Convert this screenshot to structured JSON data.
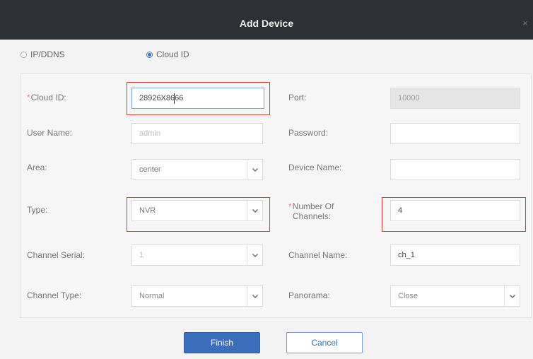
{
  "dialog": {
    "title": "Add Device",
    "close_glyph": "×"
  },
  "mode": {
    "options": [
      {
        "label": "IP/DDNS",
        "selected": false
      },
      {
        "label": "Cloud ID",
        "selected": true
      }
    ]
  },
  "form": {
    "cloud_id": {
      "label": "Cloud ID:",
      "value": "28926X8666",
      "required": true
    },
    "port": {
      "label": "Port:",
      "value": "10000"
    },
    "user_name": {
      "label": "User Name:",
      "value": "admin"
    },
    "password": {
      "label": "Password:",
      "value": ""
    },
    "area": {
      "label": "Area:",
      "value": "center"
    },
    "device_name": {
      "label": "Device Name:",
      "value": ""
    },
    "type": {
      "label": "Type:",
      "value": "NVR"
    },
    "channels": {
      "label_line1": "Number Of",
      "label_line2": "Channels:",
      "value": "4",
      "required": true
    },
    "channel_serial": {
      "label": "Channel Serial:",
      "value": "1"
    },
    "channel_name": {
      "label": "Channel Name:",
      "value": "ch_1"
    },
    "channel_type": {
      "label": "Channel Type:",
      "value": "Normal"
    },
    "panorama": {
      "label": "Panorama:",
      "value": "Close"
    }
  },
  "buttons": {
    "finish": "Finish",
    "cancel": "Cancel"
  },
  "colors": {
    "titlebar": "#2d3035",
    "accent": "#3b6fbb",
    "highlight": "#e03b3b",
    "required": "#e9897a"
  },
  "icons": {
    "dropdown": "chevron-down-icon",
    "close": "close-icon"
  }
}
